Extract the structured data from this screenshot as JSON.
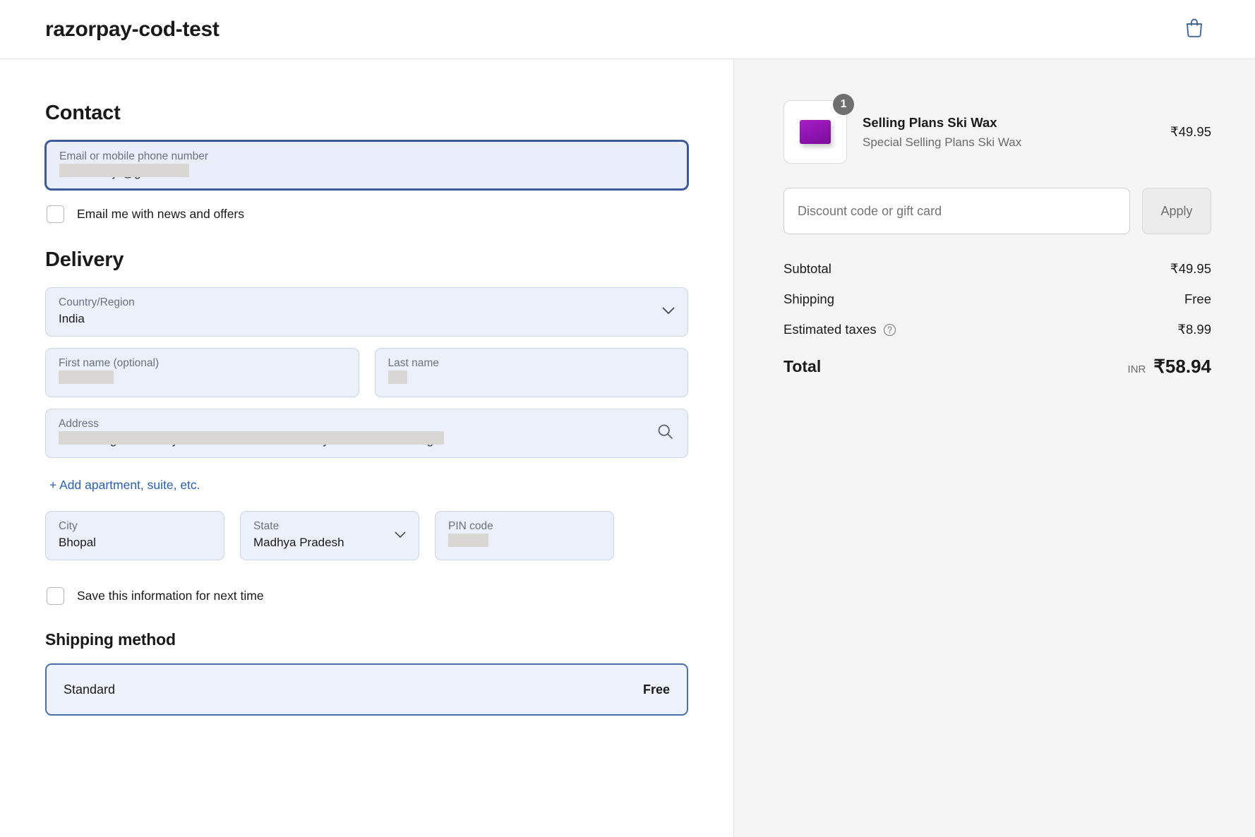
{
  "header": {
    "store_title": "razorpay-cod-test",
    "cart_icon": "shopping-bag-icon"
  },
  "contact": {
    "heading": "Contact",
    "email_field": {
      "label": "Email or mobile phone number",
      "value": "shashwatijn@gmail.com",
      "redacted": true,
      "focused": true
    },
    "newsletter_checkbox": {
      "label": "Email me with news and offers",
      "checked": false
    }
  },
  "delivery": {
    "heading": "Delivery",
    "country": {
      "label": "Country/Region",
      "value": "India",
      "icon": "chevron-down-icon"
    },
    "first_name": {
      "label": "First name (optional)",
      "value": "Shashwati",
      "redacted": true
    },
    "last_name": {
      "label": "Last name",
      "value": "Jha",
      "redacted": true
    },
    "address": {
      "label": "Address",
      "value": "LIG Cottages Bawadiya Kalan Main Road Bawadiya Kalan Pallavi Nagar",
      "redacted": true,
      "icon": "search-icon"
    },
    "add_apartment_link": "+ Add apartment, suite, etc.",
    "city": {
      "label": "City",
      "value": "Bhopal"
    },
    "state": {
      "label": "State",
      "value": "Madhya Pradesh",
      "icon": "chevron-down-icon"
    },
    "pin_code": {
      "label": "PIN code",
      "value": "462026",
      "redacted": true
    },
    "save_info_checkbox": {
      "label": "Save this information for next time",
      "checked": false
    }
  },
  "shipping_method": {
    "heading": "Shipping method",
    "selected": {
      "name": "Standard",
      "price": "Free"
    }
  },
  "order_summary": {
    "line_items": [
      {
        "title": "Selling Plans Ski Wax",
        "variant": "Special Selling Plans Ski Wax",
        "price": "₹49.95",
        "quantity": "1",
        "image": "ski-wax-thumbnail"
      }
    ],
    "discount": {
      "placeholder": "Discount code or gift card",
      "value": "",
      "apply_label": "Apply"
    },
    "totals": [
      {
        "label": "Subtotal",
        "value": "₹49.95"
      },
      {
        "label": "Shipping",
        "value": "Free"
      },
      {
        "label": "Estimated taxes",
        "value": "₹8.99",
        "has_info_icon": true
      }
    ],
    "grand_total": {
      "label": "Total",
      "currency": "INR",
      "value": "₹58.94"
    }
  },
  "colors": {
    "accent_blue": "#2b5fb4",
    "field_bg": "#ebf0fb",
    "focus_border": "#3c5a9a",
    "sidebar_bg": "#f5f5f5",
    "product_purple": "#8b12ad"
  }
}
